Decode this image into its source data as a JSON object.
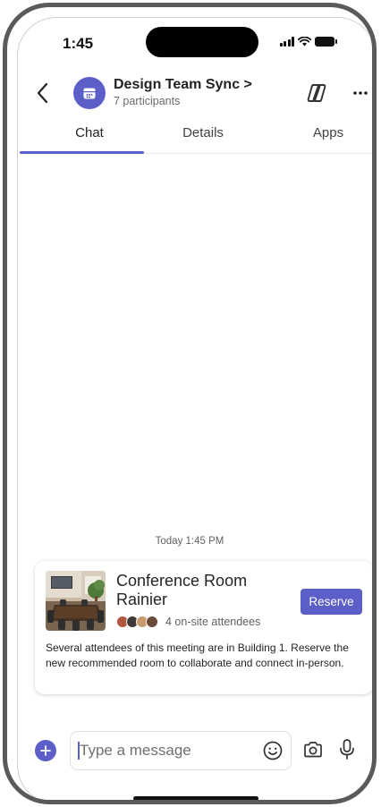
{
  "status_bar": {
    "time": "1:45"
  },
  "header": {
    "title": "Design Team Sync >",
    "subtitle": "7 participants",
    "icons": {
      "back": "chevron-left-icon",
      "avatar": "calendar-icon",
      "copilot": "copilot-icon",
      "more": "more-horizontal-icon"
    }
  },
  "tabs": [
    {
      "label": "Chat",
      "selected": true
    },
    {
      "label": "Details",
      "selected": false
    },
    {
      "label": "Apps",
      "selected": false
    }
  ],
  "conversation": {
    "timestamp": "Today 1:45 PM"
  },
  "room_card": {
    "room_name": "Conference Room Rainier",
    "attendees_label": "4 on-site attendees",
    "attendee_count": 4,
    "reserve_label": "Reserve",
    "description": "Several attendees of this meeting are in Building 1. Reserve the new recommended room to collaborate and connect in-person."
  },
  "composer": {
    "placeholder": "Type a message",
    "icons": {
      "add": "plus-icon",
      "emoji": "emoji-icon",
      "camera": "camera-icon",
      "mic": "microphone-icon"
    }
  },
  "colors": {
    "accent": "#5b5fc7",
    "frame": "#5a5a5a",
    "text_primary": "#242424",
    "text_secondary": "#616161"
  }
}
